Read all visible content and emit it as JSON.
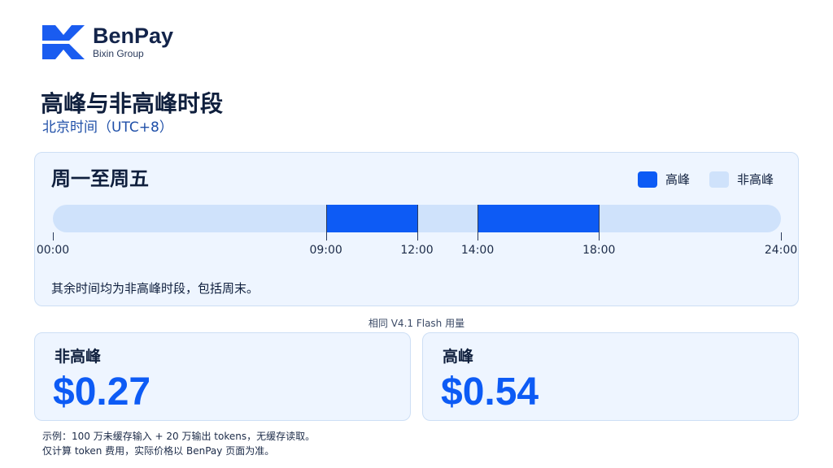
{
  "brand": {
    "name": "BenPay",
    "subtitle": "Bixin Group",
    "logo_icon": "benpay-logo-icon",
    "accent_color": "#0d5bf5",
    "offpeak_color": "#cfe2fb"
  },
  "header": {
    "title": "高峰与非高峰时段",
    "subtitle": "北京时间（UTC+8）"
  },
  "schedule": {
    "title": "周一至周五",
    "legend": {
      "peak": "高峰",
      "offpeak": "非高峰"
    },
    "day_hours": 24,
    "peak_ranges": [
      [
        9,
        12
      ],
      [
        14,
        18
      ]
    ],
    "ticks": [
      {
        "hour": 0,
        "label": "00:00"
      },
      {
        "hour": 9,
        "label": "09:00"
      },
      {
        "hour": 12,
        "label": "12:00"
      },
      {
        "hour": 14,
        "label": "14:00"
      },
      {
        "hour": 18,
        "label": "18:00"
      },
      {
        "hour": 24,
        "label": "24:00"
      }
    ],
    "note": "其余时间均为非高峰时段，包括周末。"
  },
  "pricing": {
    "caption": "相同 V4.1 Flash 用量",
    "offpeak": {
      "label": "非高峰",
      "value": "$0.27"
    },
    "peak": {
      "label": "高峰",
      "value": "$0.54"
    }
  },
  "footnotes": {
    "line1": "示例：100 万未缓存输入 + 20 万输出 tokens，无缓存读取。",
    "line2": "仅计算 token 费用，实际价格以 BenPay 页面为准。"
  }
}
